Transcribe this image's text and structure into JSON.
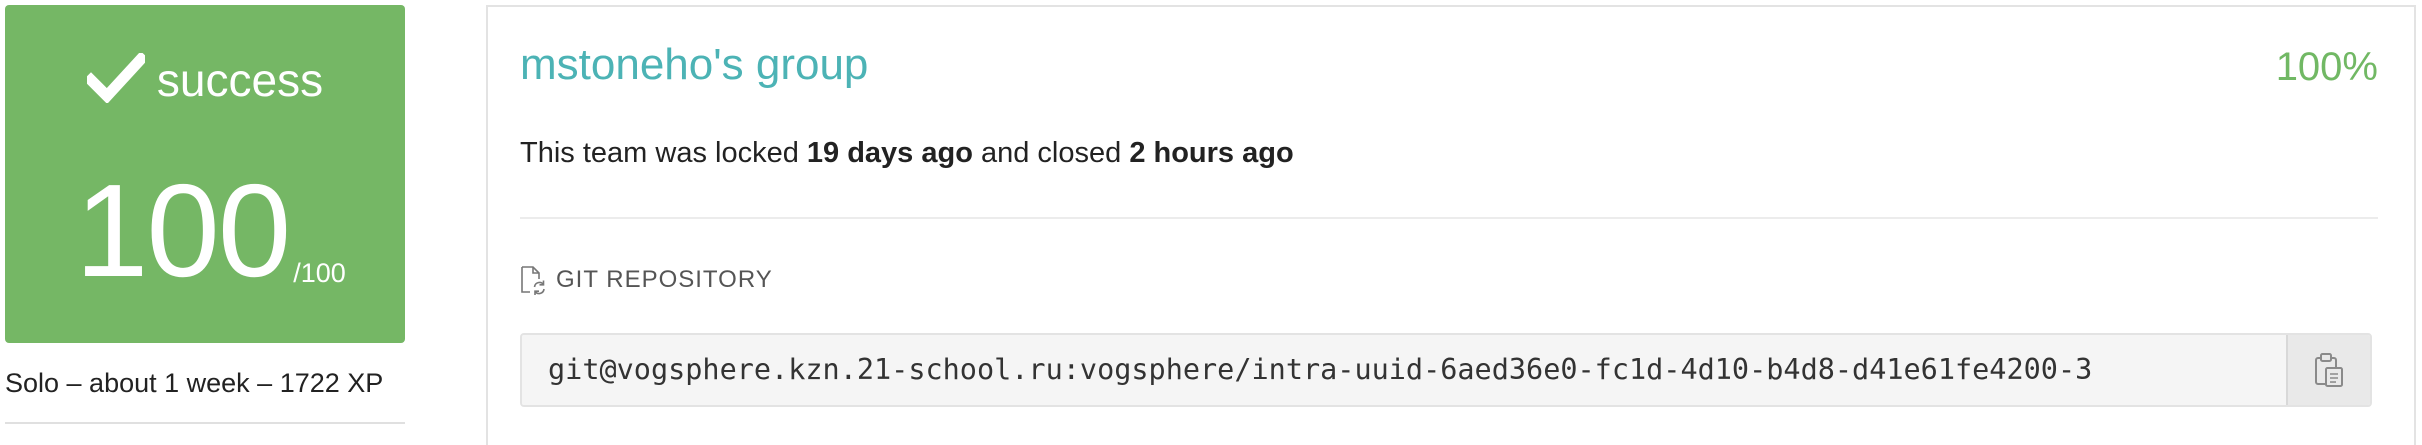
{
  "result": {
    "status_label": "success",
    "status_icon": "check-icon",
    "score": "100",
    "score_max": "/100",
    "color": "#75b765"
  },
  "project_meta": "Solo – about 1 week – 1722 XP",
  "team": {
    "name": "mstoneho's group",
    "percent": "100%",
    "lock_prefix": "This team was locked ",
    "locked_ago": "19 days ago",
    "lock_middle": " and closed ",
    "closed_ago": "2 hours ago"
  },
  "repository": {
    "header": "GIT REPOSITORY",
    "header_icon": "file-sync-icon",
    "url": "git@vogsphere.kzn.21-school.ru:vogsphere/intra-uuid-6aed36e0-fc1d-4d10-b4d8-d41e61fe4200-3",
    "copy_icon": "clipboard-icon"
  },
  "colors": {
    "accent_teal": "#4cb3b5",
    "success_green": "#71b864"
  }
}
